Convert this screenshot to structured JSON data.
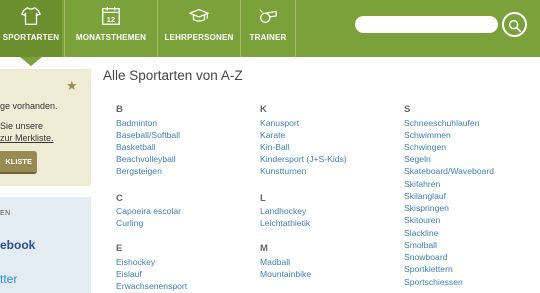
{
  "nav": {
    "items": [
      {
        "label": "SPORTARTEN",
        "icon": "shirt-icon",
        "active": true
      },
      {
        "label": "MONATSTHEMEN",
        "icon": "calendar-icon",
        "calendar_day": "12"
      },
      {
        "label": "LEHRPERSONEN",
        "icon": "graduation-cap-icon"
      },
      {
        "label": "TRAINER",
        "icon": "whistle-icon"
      }
    ]
  },
  "search": {
    "value": "",
    "placeholder": "",
    "icon": "search-icon"
  },
  "sidebar": {
    "star_icon": "star-icon",
    "line1": "ge vorhanden.",
    "line2": "Sie unsere",
    "line3": "zur Merkliste.",
    "button": "KLISTE",
    "section_label": "EN",
    "facebook": "ebook",
    "twitter": "tter"
  },
  "main": {
    "title": "Alle Sportarten von A-Z",
    "groups": [
      {
        "letter": "B",
        "items": [
          "Badminton",
          "Baseball/Softball",
          "Basketball",
          "Beachvolleyball",
          "Bergsteigen"
        ]
      },
      {
        "letter": "C",
        "items": [
          "Capoeira escolar",
          "Curling"
        ]
      },
      {
        "letter": "E",
        "items": [
          "Eishockey",
          "Eislauf",
          "Erwachsenensport"
        ]
      },
      {
        "letter": "K",
        "items": [
          "Kanusport",
          "Karate",
          "Kin-Ball",
          "Kindersport (J+S-Kids)",
          "Kunstturnen"
        ]
      },
      {
        "letter": "L",
        "items": [
          "Landhockey",
          "Leichtathletik"
        ]
      },
      {
        "letter": "M",
        "items": [
          "Madball",
          "Mountainbike"
        ]
      },
      {
        "letter": "S",
        "items": [
          "Schneeschuhlaufen",
          "Schwimmen",
          "Schwingen",
          "Segeln",
          "Skateboard/Waveboard",
          "Skifahren",
          "Skilanglauf",
          "Skispringen",
          "Skitouren",
          "Slackline",
          "Smolball",
          "Snowboard",
          "Sportklettern",
          "Sportschiessen"
        ]
      }
    ]
  },
  "colors": {
    "nav_green": "#7ba23a",
    "link_blue": "#3f7fb5",
    "sidebar_beige": "#efecd6",
    "sidebar_blue": "#e3ebf3"
  }
}
